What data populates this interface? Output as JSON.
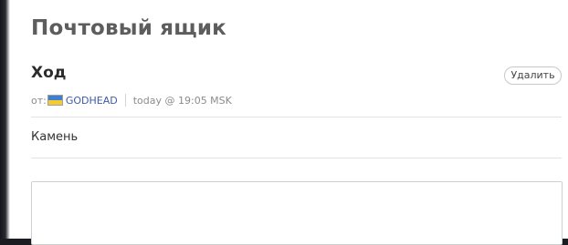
{
  "page": {
    "title": "Почтовый ящик"
  },
  "message": {
    "subject": "Ход",
    "delete_label": "Удалить",
    "from_label": "от:",
    "author": "GODHEAD",
    "timestamp": "today @ 19:05 MSK",
    "body": "Камень"
  },
  "reply": {
    "value": "",
    "placeholder": ""
  },
  "colors": {
    "flag_top": "#3f7fd0",
    "flag_bottom": "#f3cc33",
    "author_link": "#3f5aa6"
  },
  "icons": {
    "author_flag": "ukraine-flag-icon"
  }
}
